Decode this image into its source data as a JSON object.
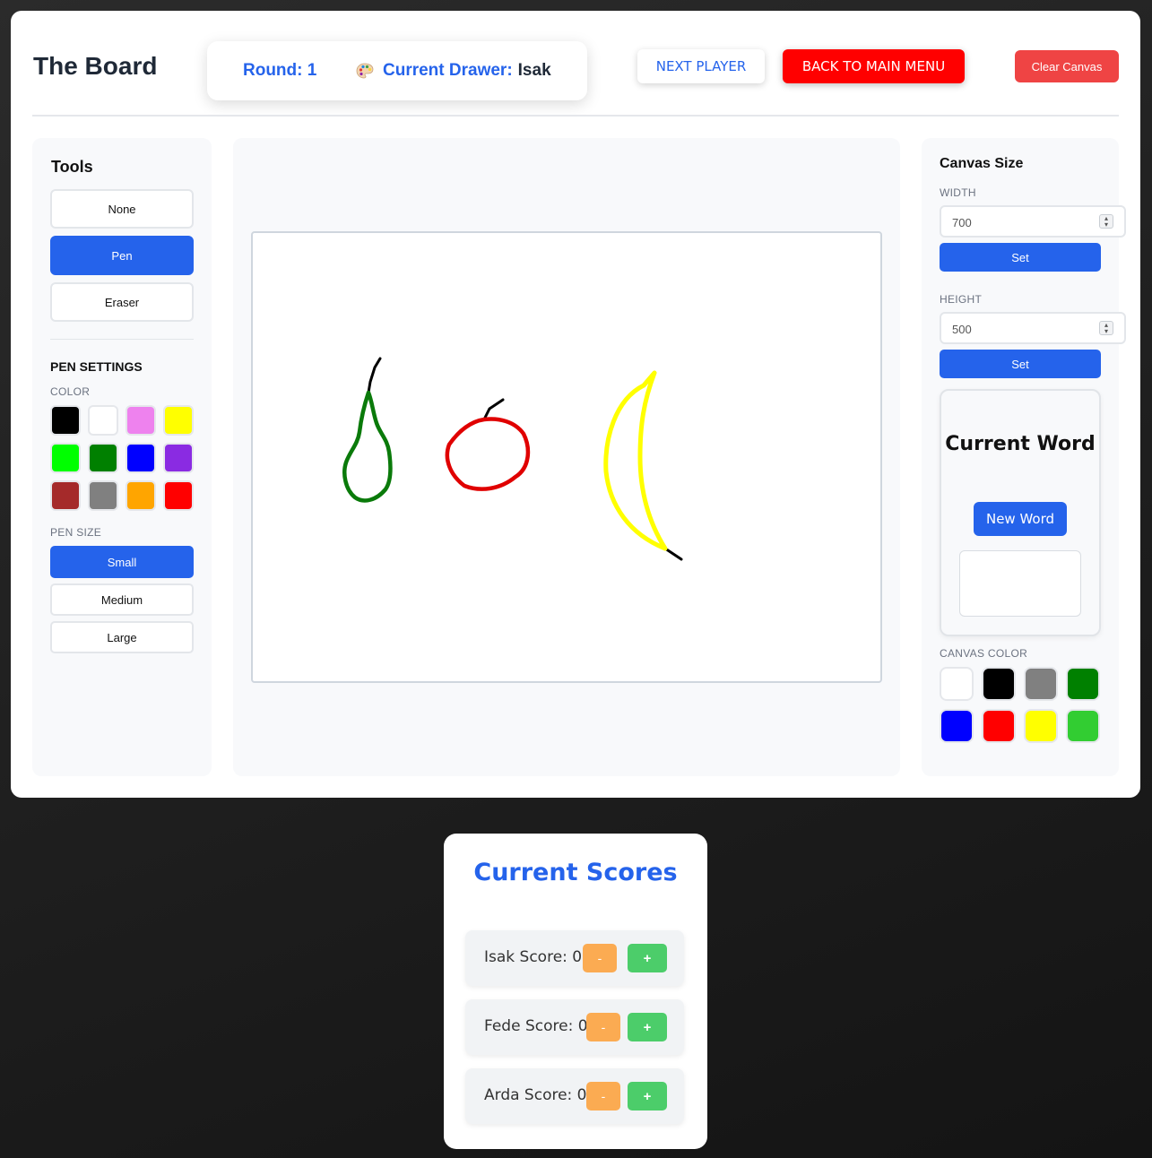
{
  "header": {
    "title": "The Board",
    "round_label": "Round: 1",
    "drawer_label": "Current Drawer:",
    "drawer_name": "Isak",
    "next_player": "NEXT PLAYER",
    "back_to_menu": "BACK TO MAIN MENU",
    "clear_canvas": "Clear Canvas",
    "palette_icon": "palette-icon"
  },
  "tools": {
    "title": "Tools",
    "items": [
      {
        "label": "None",
        "active": false
      },
      {
        "label": "Pen",
        "active": true
      },
      {
        "label": "Eraser",
        "active": false
      }
    ],
    "pen_settings_title": "PEN SETTINGS",
    "color_label": "COLOR",
    "colors": [
      "#000000",
      "#ffffff",
      "#ee82ee",
      "#ffff00",
      "#00ff00",
      "#008000",
      "#0000ff",
      "#8a2be2",
      "#a52a2a",
      "#808080",
      "#ffa500",
      "#ff0000"
    ],
    "pen_size_label": "PEN SIZE",
    "sizes": [
      {
        "label": "Small",
        "active": true
      },
      {
        "label": "Medium",
        "active": false
      },
      {
        "label": "Large",
        "active": false
      }
    ]
  },
  "canvas_settings": {
    "title": "Canvas Size",
    "width_label": "WIDTH",
    "width_value": "700",
    "height_label": "HEIGHT",
    "height_value": "500",
    "set_label": "Set",
    "canvas_color_label": "CANVAS COLOR",
    "canvas_colors": [
      "#ffffff",
      "#000000",
      "#808080",
      "#008000",
      "#0000ff",
      "#ff0000",
      "#ffff00",
      "#32cd32"
    ]
  },
  "word_card": {
    "title": "Current Word",
    "new_word": "New Word",
    "word": ""
  },
  "scores": {
    "title": "Current Scores",
    "players": [
      {
        "label": "Isak Score: 0"
      },
      {
        "label": "Fede Score: 0"
      },
      {
        "label": "Arda Score: 0"
      }
    ],
    "minus": "-",
    "plus": "+"
  }
}
